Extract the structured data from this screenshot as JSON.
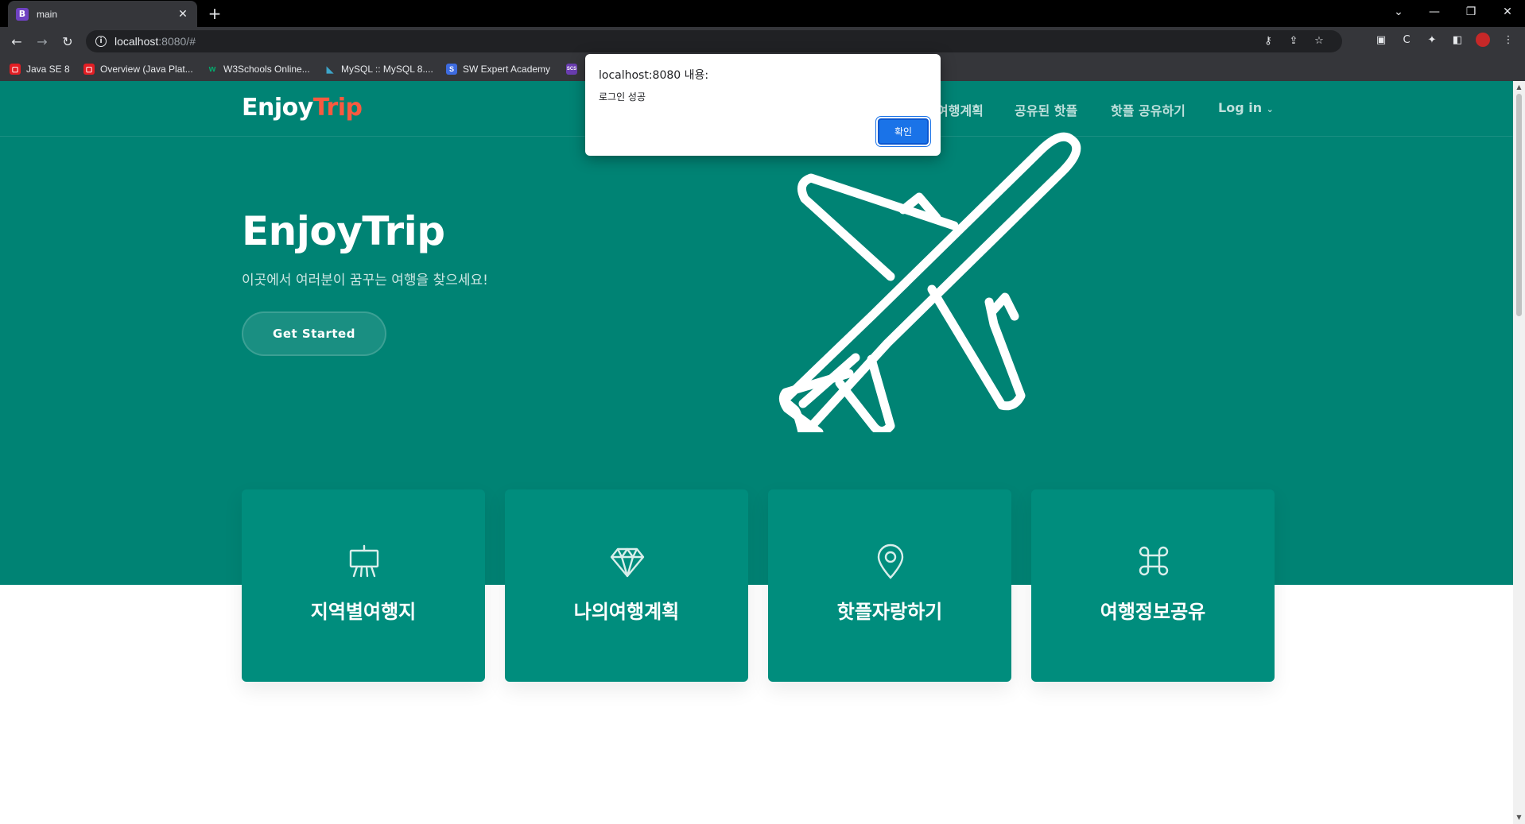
{
  "browser": {
    "tab_title": "main",
    "tab_favicon": "B",
    "url_host": "localhost",
    "url_path": ":8080/#",
    "bookmarks": [
      {
        "label": "Java SE 8",
        "icon": "oracle-icon",
        "color": "#e31e24"
      },
      {
        "label": "Overview (Java Plat...",
        "icon": "oracle-icon",
        "color": "#e31e24"
      },
      {
        "label": "W3Schools Online...",
        "icon": "w3schools-icon",
        "color": "#04aa6d"
      },
      {
        "label": "MySQL :: MySQL 8....",
        "icon": "mysql-icon",
        "color": "#00758f"
      },
      {
        "label": "SW Expert Academy",
        "icon": "swea-icon",
        "color": "#3d6bdf"
      },
      {
        "label": "SCS",
        "icon": "scs-icon",
        "color": "#6a3db0"
      }
    ]
  },
  "site": {
    "logo_main": "Enjoy",
    "logo_accent": "Trip",
    "nav": [
      "여행계획",
      "공유된 핫플",
      "핫플 공유하기",
      "Log in"
    ],
    "hero_title": "EnjoyTrip",
    "hero_subtitle": "이곳에서 여러분이 꿈꾸는 여행을 찾으세요!",
    "cta_label": "Get Started",
    "cards": [
      {
        "title": "지역별여행지",
        "icon": "easel-icon"
      },
      {
        "title": "나의여행계획",
        "icon": "gem-icon"
      },
      {
        "title": "핫플자랑하기",
        "icon": "geo-pin-icon"
      },
      {
        "title": "여행정보공유",
        "icon": "command-icon"
      }
    ]
  },
  "dialog": {
    "title": "localhost:8080 내용:",
    "message": "로그인 성공",
    "ok_label": "확인"
  },
  "colors": {
    "brand": "#008374",
    "card": "#008d7d",
    "accent": "#f85a40",
    "dialog_button": "#1a73e8"
  }
}
